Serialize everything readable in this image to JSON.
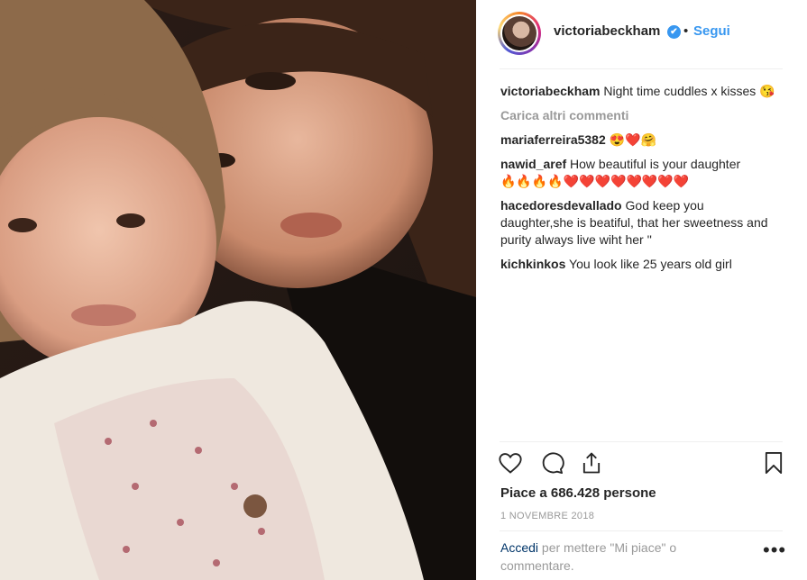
{
  "header": {
    "username": "victoriabeckham",
    "verified_icon": "✔",
    "separator": "•",
    "follow_label": "Segui"
  },
  "caption": {
    "username": "victoriabeckham",
    "text": "Night time cuddles x kisses 😘"
  },
  "load_more_label": "Carica altri commenti",
  "comments": [
    {
      "username": "mariaferreira5382",
      "text": "😍❤️🤗"
    },
    {
      "username": "nawid_aref",
      "text": "How beautiful is your daughter",
      "emoji": "🔥🔥🔥🔥❤️❤️❤️❤️❤️❤️❤️❤️"
    },
    {
      "username": "hacedoresdevallado",
      "text": "God keep you daughter,she is beatiful, that her sweetness and purity always live wiht her ''"
    },
    {
      "username": "kichkinkos",
      "text": "You look like 25 years old girl"
    }
  ],
  "likes_text": "Piace a 686.428 persone",
  "date_text": "1 NOVEMBRE 2018",
  "footer": {
    "login_label": "Accedi",
    "rest_text": "per mettere \"Mi piace\" o commentare.",
    "more_label": "•••"
  },
  "icons": {
    "like": "heart-icon",
    "comment": "comment-icon",
    "share": "share-icon",
    "save": "bookmark-icon"
  },
  "colors": {
    "accent": "#3897f0",
    "link_dark": "#003569",
    "muted": "#999999",
    "text": "#262626"
  }
}
